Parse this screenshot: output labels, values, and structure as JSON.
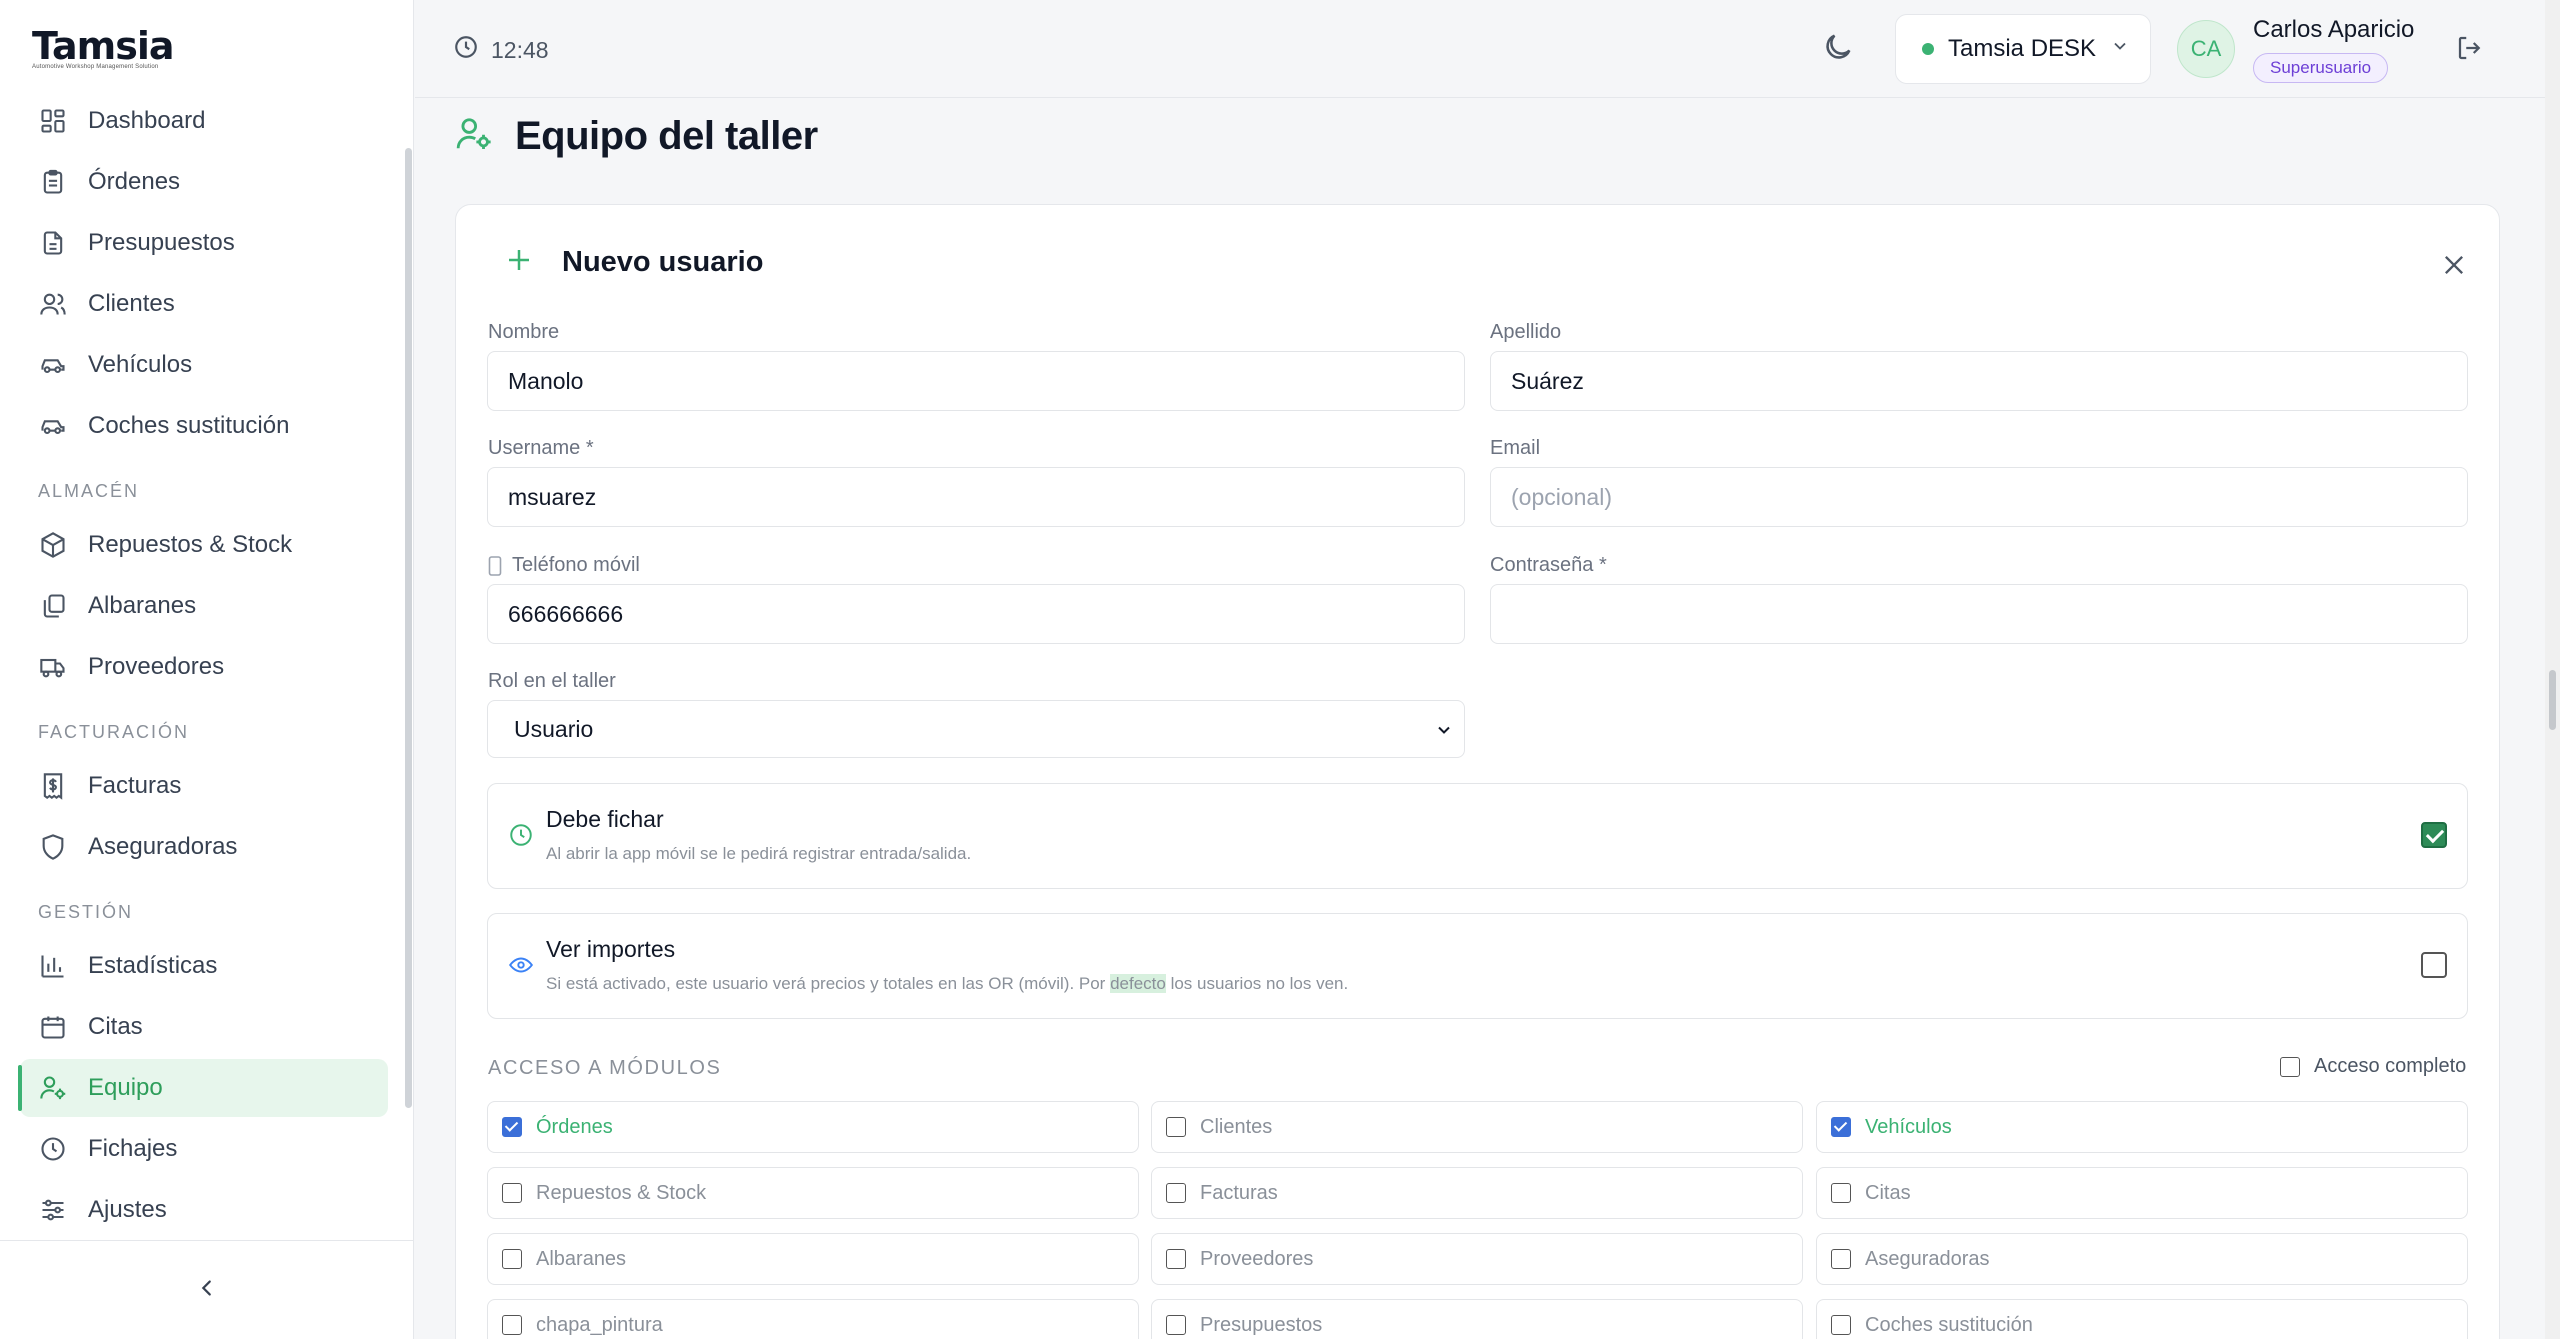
{
  "app": {
    "logo": "Tamsia",
    "logo_tagline": "Automotive Workshop Management Solution"
  },
  "sidebar": {
    "items": [
      {
        "label": "Dashboard",
        "icon": "dashboard-icon"
      },
      {
        "label": "Órdenes",
        "icon": "clipboard-icon"
      },
      {
        "label": "Presupuestos",
        "icon": "document-icon"
      },
      {
        "label": "Clientes",
        "icon": "users-icon"
      },
      {
        "label": "Vehículos",
        "icon": "car-icon"
      },
      {
        "label": "Coches sustitución",
        "icon": "car-icon"
      }
    ],
    "section_almacen": "ALMACÉN",
    "almacen_items": [
      {
        "label": "Repuestos & Stock",
        "icon": "box-icon"
      },
      {
        "label": "Albaranes",
        "icon": "copy-icon"
      },
      {
        "label": "Proveedores",
        "icon": "truck-icon"
      }
    ],
    "section_facturacion": "FACTURACIÓN",
    "facturacion_items": [
      {
        "label": "Facturas",
        "icon": "invoice-icon"
      },
      {
        "label": "Aseguradoras",
        "icon": "shield-icon"
      }
    ],
    "section_gestion": "GESTIÓN",
    "gestion_items": [
      {
        "label": "Estadísticas",
        "icon": "bar-chart-icon"
      },
      {
        "label": "Citas",
        "icon": "calendar-icon"
      },
      {
        "label": "Equipo",
        "icon": "user-gear-icon",
        "active": true
      },
      {
        "label": "Fichajes",
        "icon": "clock-icon"
      },
      {
        "label": "Ajustes",
        "icon": "sliders-icon"
      }
    ]
  },
  "header": {
    "time": "12:48",
    "workspace": "Tamsia DESK",
    "avatar_initials": "CA",
    "user_name": "Carlos Aparicio",
    "user_role": "Superusuario"
  },
  "page": {
    "title": "Equipo del taller"
  },
  "form": {
    "title": "Nuevo usuario",
    "nombre_label": "Nombre",
    "nombre_value": "Manolo",
    "apellido_label": "Apellido",
    "apellido_value": "Suárez",
    "username_label": "Username *",
    "username_value": "msuarez",
    "email_label": "Email",
    "email_placeholder": "(opcional)",
    "telefono_label": "Teléfono móvil",
    "telefono_value": "666666666",
    "password_label": "Contraseña *",
    "password_value": "",
    "rol_label": "Rol en el taller",
    "rol_value": "Usuario",
    "fichar": {
      "title": "Debe fichar",
      "desc": "Al abrir la app móvil se le pedirá registrar entrada/salida.",
      "checked": true
    },
    "importes": {
      "title": "Ver importes",
      "desc_a": "Si está activado, este usuario verá precios y totales en las OR (móvil). Por ",
      "desc_hl": "defecto",
      "desc_b": " los usuarios no los ven.",
      "checked": false
    },
    "modules_title": "ACCESO A MÓDULOS",
    "full_access_label": "Acceso completo",
    "modules": [
      {
        "label": "Órdenes",
        "checked": true
      },
      {
        "label": "Clientes",
        "checked": false
      },
      {
        "label": "Vehículos",
        "checked": true
      },
      {
        "label": "Repuestos & Stock",
        "checked": false
      },
      {
        "label": "Facturas",
        "checked": false
      },
      {
        "label": "Citas",
        "checked": false
      },
      {
        "label": "Albaranes",
        "checked": false
      },
      {
        "label": "Proveedores",
        "checked": false
      },
      {
        "label": "Aseguradoras",
        "checked": false
      },
      {
        "label": "chapa_pintura",
        "checked": false
      },
      {
        "label": "Presupuestos",
        "checked": false
      },
      {
        "label": "Coches sustitución",
        "checked": false
      }
    ]
  },
  "colors": {
    "accent": "#3bb273",
    "active_bg": "#e7f6ec",
    "badge": "#6d3fd6",
    "check_blue": "#3b6fd8",
    "check_green": "#2e8b57"
  }
}
